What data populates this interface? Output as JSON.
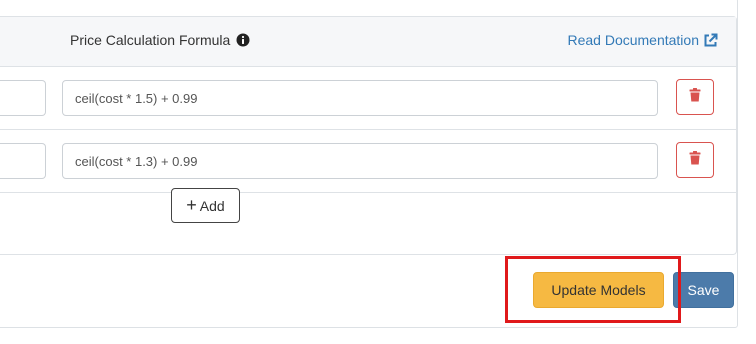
{
  "table": {
    "header": {
      "formula_label": "Price Calculation Formula",
      "info_icon": "info-circle-icon",
      "doc_link": "Read Documentation",
      "doc_icon": "external-link-icon"
    },
    "rows": [
      {
        "formula": "ceil(cost * 1.5) + 0.99",
        "delete_icon": "trash-icon"
      },
      {
        "formula": "ceil(cost * 1.3) + 0.99",
        "delete_icon": "trash-icon"
      }
    ],
    "add_button": {
      "icon": "+",
      "label": "Add"
    }
  },
  "actions": {
    "update_label": "Update Models",
    "save_label": "Save"
  },
  "colors": {
    "link": "#337ab7",
    "danger": "#d9534f",
    "warning": "#f6b942",
    "primary": "#4c7baa",
    "highlight": "#e0191b"
  }
}
